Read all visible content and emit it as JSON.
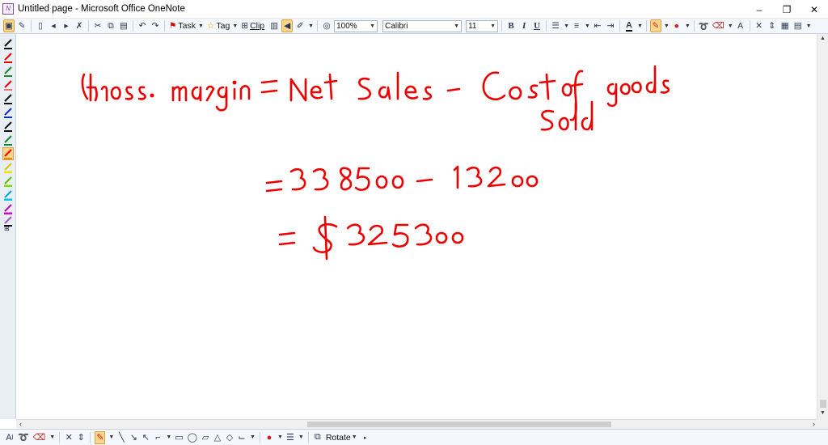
{
  "window": {
    "title": "Untitled page - Microsoft Office OneNote",
    "minimize": "–",
    "restore": "❐",
    "close": "✕"
  },
  "toolbar": {
    "task_label": "Task",
    "tag_label": "Tag",
    "clip_label": "Clip",
    "zoom_value": "100%",
    "font_value": "Calibri",
    "font_size_value": "11",
    "bold": "B",
    "italic": "I",
    "underline": "U",
    "clear_format": "A"
  },
  "ink_colors": {
    "red": "#ee0000",
    "black": "#111111",
    "blue": "#1030c8",
    "green": "#1a8a2a",
    "orange": "#f08a00",
    "yellow": "#e8e800",
    "cyan": "#00c8e8",
    "magenta": "#e000c8"
  },
  "handwriting": {
    "line1": "Gross margin = Net Sales - Cost of goods sold",
    "line2": "= 338500 - 13200",
    "line3": "= $ 325300"
  },
  "drawbar": {
    "text_mode": "A",
    "rotate_label": "Rotate"
  }
}
